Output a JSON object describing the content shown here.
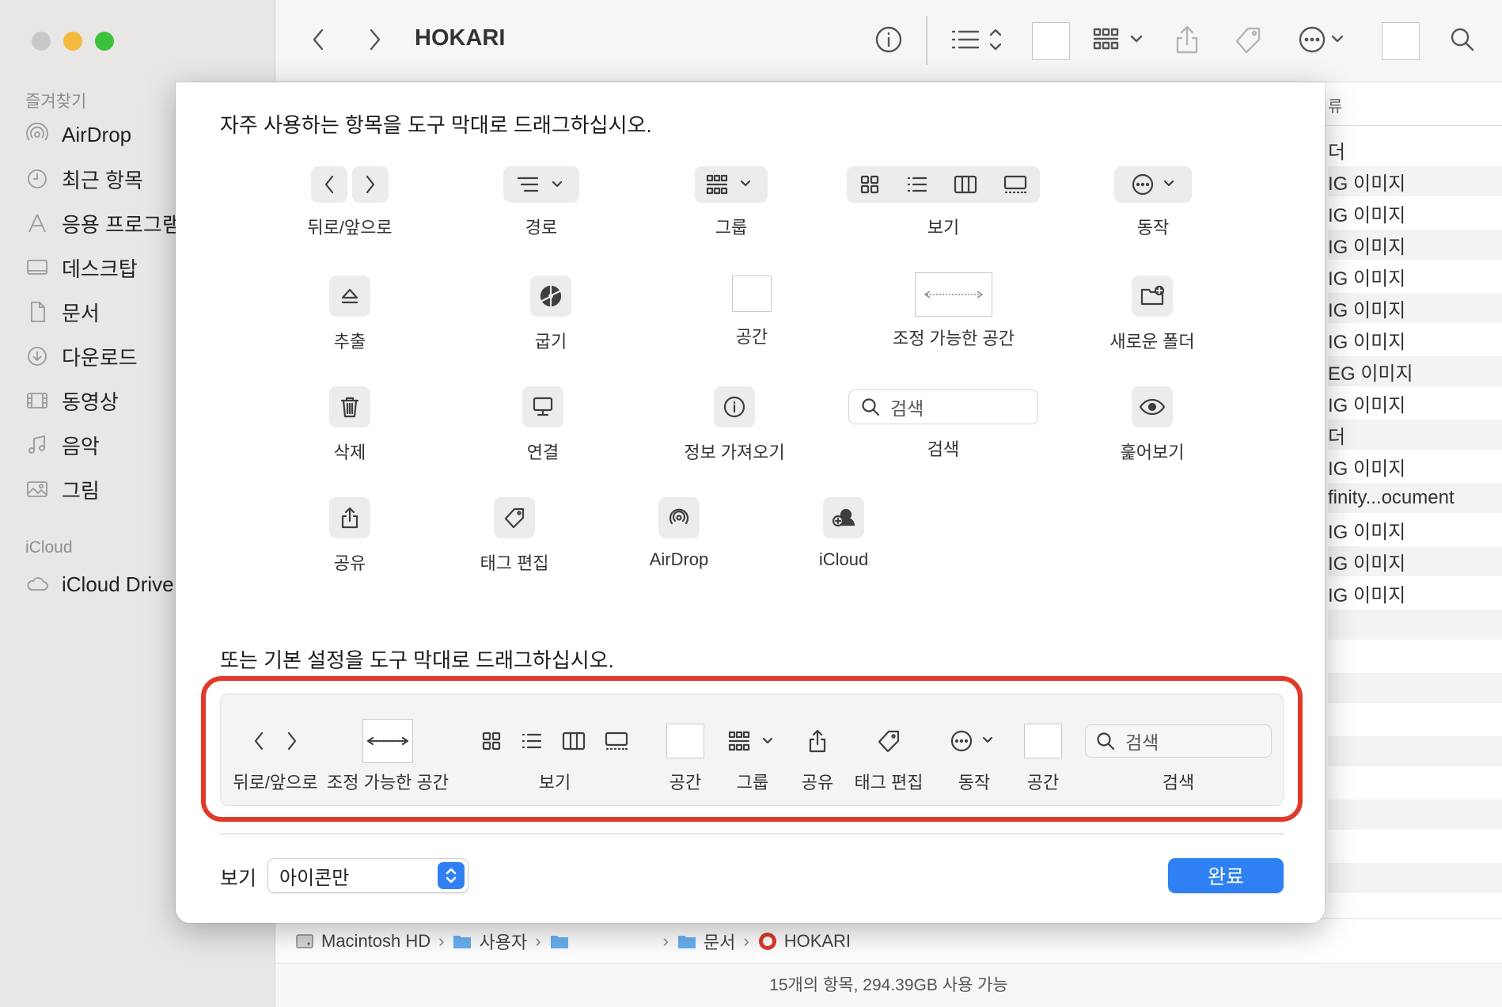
{
  "window": {
    "title": "HOKARI"
  },
  "sidebar": {
    "favorites_header": "즐겨찾기",
    "favorites": [
      {
        "label": "AirDrop",
        "icon": "airdrop-icon"
      },
      {
        "label": "최근 항목",
        "icon": "clock-icon"
      },
      {
        "label": "응용 프로그램",
        "icon": "applications-icon"
      },
      {
        "label": "데스크탑",
        "icon": "desktop-icon"
      },
      {
        "label": "문서",
        "icon": "document-icon"
      },
      {
        "label": "다운로드",
        "icon": "download-icon"
      },
      {
        "label": "동영상",
        "icon": "film-icon"
      },
      {
        "label": "음악",
        "icon": "music-icon"
      },
      {
        "label": "그림",
        "icon": "photo-icon"
      }
    ],
    "icloud_header": "iCloud",
    "icloud": [
      {
        "label": "iCloud Drive",
        "icon": "cloud-icon"
      }
    ]
  },
  "file_list": {
    "header_fragment": "류",
    "rows": [
      "더",
      "IG 이미지",
      "IG 이미지",
      "IG 이미지",
      "IG 이미지",
      "IG 이미지",
      "IG 이미지",
      "EG 이미지",
      "IG 이미지",
      "더",
      "IG 이미지",
      "finity...ocument",
      "IG 이미지",
      "IG 이미지",
      "IG 이미지"
    ]
  },
  "customize": {
    "heading": "자주 사용하는 항목을 도구 막대로 드래그하십시오.",
    "palette": {
      "back_forward": "뒤로/앞으로",
      "path": "경로",
      "group": "그룹",
      "view": "보기",
      "action": "동작",
      "eject": "추출",
      "burn": "굽기",
      "space": "공간",
      "flexible_space": "조정 가능한 공간",
      "new_folder": "새로운 폴더",
      "delete": "삭제",
      "connect": "연결",
      "get_info": "정보 가져오기",
      "search_placeholder": "검색",
      "search": "검색",
      "quick_look": "훑어보기",
      "share": "공유",
      "edit_tags": "태그 편집",
      "airdrop": "AirDrop",
      "icloud": "iCloud"
    },
    "default_heading": "또는 기본 설정을 도구 막대로 드래그하십시오.",
    "default_set": {
      "back_forward": "뒤로/앞으로",
      "flexible_space": "조정 가능한 공간",
      "view": "보기",
      "space1": "공간",
      "group": "그룹",
      "share": "공유",
      "edit_tags": "태그 편집",
      "action": "동작",
      "space2": "공간",
      "search_placeholder": "검색",
      "search": "검색"
    },
    "show_label": "보기",
    "show_value": "아이콘만",
    "done_button": "완료"
  },
  "path_bar": {
    "segments": [
      "Macintosh HD",
      "사용자",
      "",
      "문서",
      "HOKARI"
    ]
  },
  "status_bar": {
    "text": "15개의 항목, 294.39GB 사용 가능"
  },
  "colors": {
    "accent": "#2f80f3",
    "highlight": "#e03a2a",
    "close": "#c8c8c8",
    "minimize": "#f5b93e",
    "zoom": "#3fc140"
  }
}
